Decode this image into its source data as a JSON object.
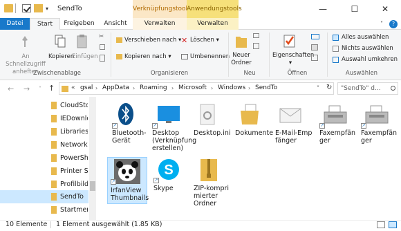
{
  "window": {
    "title": "SendTo"
  },
  "context_tabs": {
    "tools1": "Verknüpfungstools",
    "tools2": "Anwendungstools"
  },
  "tabs": {
    "datei": "Datei",
    "start": "Start",
    "freigeben": "Freigeben",
    "ansicht": "Ansicht",
    "verwalten1": "Verwalten",
    "verwalten2": "Verwalten"
  },
  "ribbon": {
    "pin_l1": "An Schnellzugriff",
    "pin_l2": "anheften",
    "copy": "Kopieren",
    "paste": "Einfügen",
    "grp_clipboard": "Zwischenablage",
    "move_to": "Verschieben nach",
    "copy_to": "Kopieren nach",
    "delete": "Löschen",
    "rename": "Umbenennen",
    "grp_organize": "Organisieren",
    "new_folder_l1": "Neuer",
    "new_folder_l2": "Ordner",
    "grp_new": "Neu",
    "properties": "Eigenschaften",
    "grp_open": "Öffnen",
    "select_all": "Alles auswählen",
    "select_none": "Nichts auswählen",
    "invert": "Auswahl umkehren",
    "grp_select": "Auswählen"
  },
  "address": {
    "crumbs": [
      "gsal",
      "AppData",
      "Roaming",
      "Microsoft",
      "Windows",
      "SendTo"
    ],
    "search_placeholder": "\"SendTo\" d..."
  },
  "nav": [
    "CloudStor",
    "IEDownlo",
    "Libraries",
    "Network S",
    "PowerShe",
    "Printer Sh",
    "Profilbild",
    "SendTo",
    "Startmen"
  ],
  "files": [
    {
      "l1": "Bluetooth-",
      "l2": "Gerät",
      "l3": ""
    },
    {
      "l1": "Desktop",
      "l2": "(Verknüpfung",
      "l3": "erstellen)"
    },
    {
      "l1": "Desktop.ini",
      "l2": "",
      "l3": ""
    },
    {
      "l1": "Dokumente",
      "l2": "",
      "l3": ""
    },
    {
      "l1": "E-Mail-Emp",
      "l2": "fänger",
      "l3": ""
    },
    {
      "l1": "Faxempfän",
      "l2": "ger",
      "l3": ""
    },
    {
      "l1": "Faxempfän",
      "l2": "ger",
      "l3": ""
    },
    {
      "l1": "IrfanView",
      "l2": "Thumbnails",
      "l3": ""
    },
    {
      "l1": "Skype",
      "l2": "",
      "l3": ""
    },
    {
      "l1": "ZIP-kompri",
      "l2": "mierter",
      "l3": "Ordner"
    }
  ],
  "status": {
    "count": "10 Elemente",
    "selection": "1 Element ausgewählt (1.85 KB)"
  },
  "colors": {
    "accent": "#1979ca",
    "selection": "#cce8ff",
    "folder": "#e8b94d"
  }
}
